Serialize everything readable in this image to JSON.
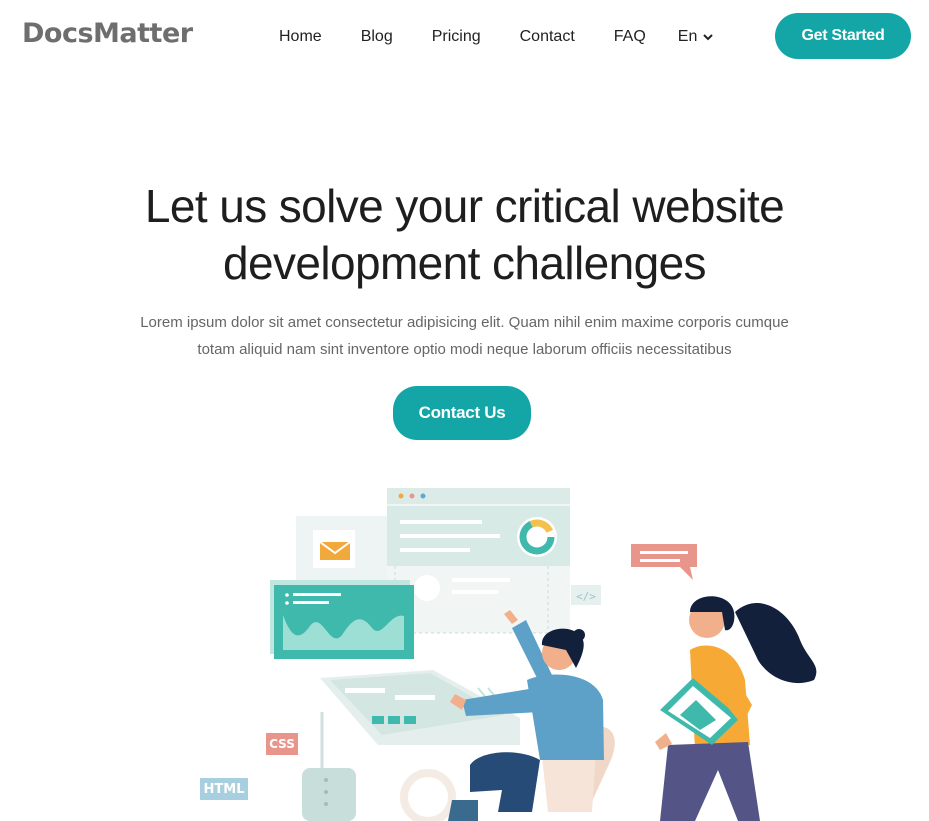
{
  "header": {
    "logo_text": "DocsMatter",
    "nav": [
      "Home",
      "Blog",
      "Pricing",
      "Contact",
      "FAQ"
    ],
    "language": "En",
    "cta_label": "Get Started"
  },
  "hero": {
    "title_line1": "Let us solve your critical website",
    "title_line2": "development challenges",
    "subtitle_line1": "Lorem ipsum dolor sit amet consectetur adipisicing elit. Quam nihil enim maxime corporis cumque",
    "subtitle_line2": "totam aliquid nam sint inventore optio modi neque laborum officiis necessitatibus",
    "cta_label": "Contact Us"
  },
  "illustration": {
    "tag_css": "CSS",
    "tag_html": "HTML",
    "code_tag": "</>"
  },
  "colors": {
    "accent": "#14a5a6",
    "logo": "#6e6e6e",
    "title": "#1e1e1e",
    "subtitle": "#666666"
  }
}
